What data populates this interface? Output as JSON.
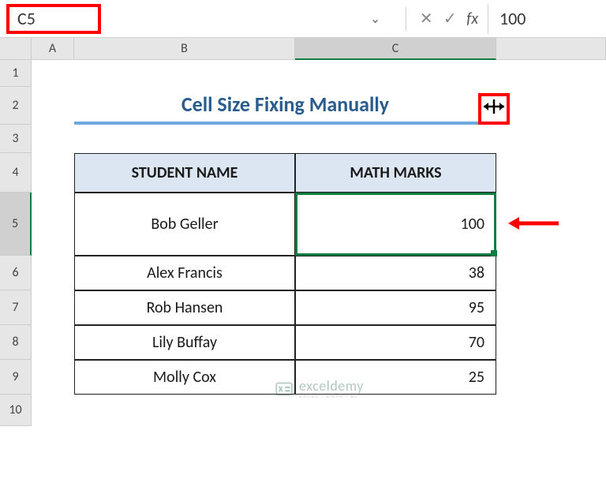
{
  "formula_bar": {
    "name_box": "C5",
    "formula_value": "100",
    "fx_label": "fx",
    "cancel_icon": "✕",
    "confirm_icon": "✓",
    "dropdown_icon": "⌄"
  },
  "columns": [
    "A",
    "B",
    "C"
  ],
  "rows": [
    "1",
    "2",
    "3",
    "4",
    "5",
    "6",
    "7",
    "8",
    "9",
    "10"
  ],
  "title": "Cell Size Fixing Manually",
  "table": {
    "headers": {
      "student": "STUDENT NAME",
      "marks": "MATH MARKS"
    },
    "data": [
      {
        "name": "Bob Geller",
        "marks": "100"
      },
      {
        "name": "Alex Francis",
        "marks": "38"
      },
      {
        "name": "Rob Hansen",
        "marks": "95"
      },
      {
        "name": "Lily Buffay",
        "marks": "70"
      },
      {
        "name": "Molly Cox",
        "marks": "25"
      }
    ]
  },
  "watermark": {
    "main": "exceldemy",
    "sub": "EXCEL · DATA · BI"
  },
  "annotations": {
    "resize_cursor": "↔",
    "arrow": "⟵"
  }
}
